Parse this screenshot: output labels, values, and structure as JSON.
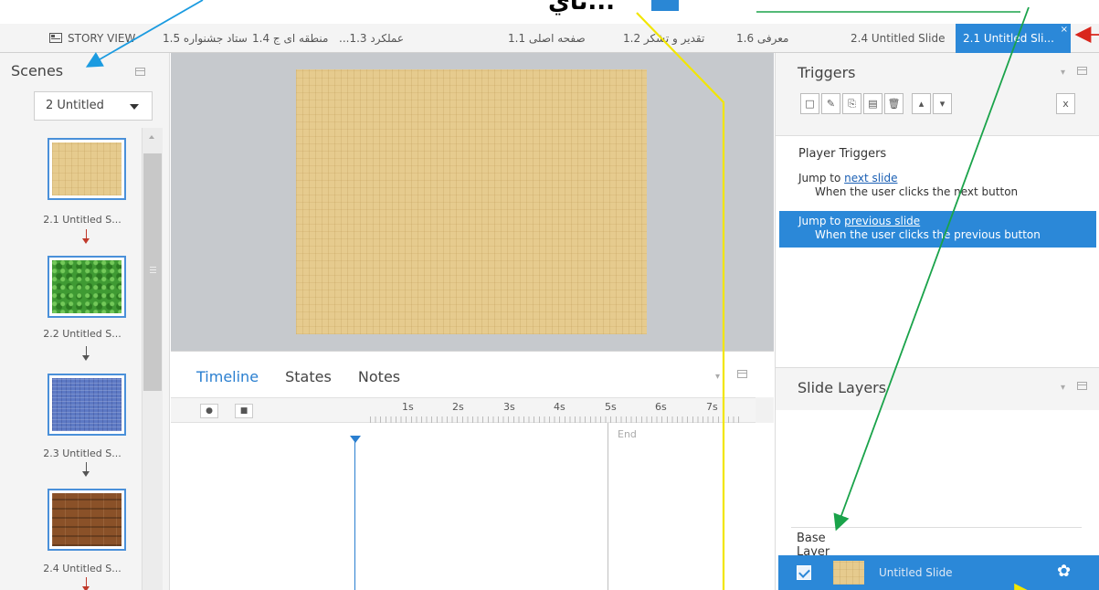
{
  "caption": {
    "text": "ئاي..."
  },
  "tabs": {
    "story_view": "STORY VIEW",
    "items": [
      "ستاد جشنواره 1.5",
      "منطقه ای ج 1.4",
      "...عملکرد 1.3",
      "صفحه اصلی 1.1",
      "تقدیر و تشکر 1.2",
      "معرفی 1.6",
      "2.4 Untitled Slide"
    ],
    "active": "2.1 Untitled Sli...",
    "close": "×"
  },
  "scenes": {
    "title": "Scenes",
    "selected_scene": "2 Untitled",
    "thumbs": [
      {
        "label": "2.1 Untitled S...",
        "texture": "wood"
      },
      {
        "label": "2.2 Untitled S...",
        "texture": "grass"
      },
      {
        "label": "2.3 Untitled S...",
        "texture": "blue"
      },
      {
        "label": "2.4 Untitled S...",
        "texture": "brown"
      }
    ]
  },
  "timeline": {
    "tabs": [
      "Timeline",
      "States",
      "Notes"
    ],
    "ticks": [
      "1s",
      "2s",
      "3s",
      "4s",
      "5s",
      "6s",
      "7s"
    ],
    "end_label": "End"
  },
  "triggers": {
    "title": "Triggers",
    "player_triggers_heading": "Player Triggers",
    "items": [
      {
        "prefix": "Jump to ",
        "link": "next slide",
        "condition": "When the user clicks the next button"
      },
      {
        "prefix": "Jump to ",
        "link": "previous slide",
        "condition": "When the user clicks the previous button"
      }
    ]
  },
  "layers": {
    "title": "Slide Layers",
    "base_layer_heading": "Base Layer",
    "base_layer_name": "Untitled Slide"
  },
  "colors": {
    "accent": "#2b88d8",
    "annotation_blue": "#1b9be0",
    "annotation_green": "#1aa34a",
    "annotation_yellow": "#f2e600",
    "annotation_red": "#d9261c"
  }
}
